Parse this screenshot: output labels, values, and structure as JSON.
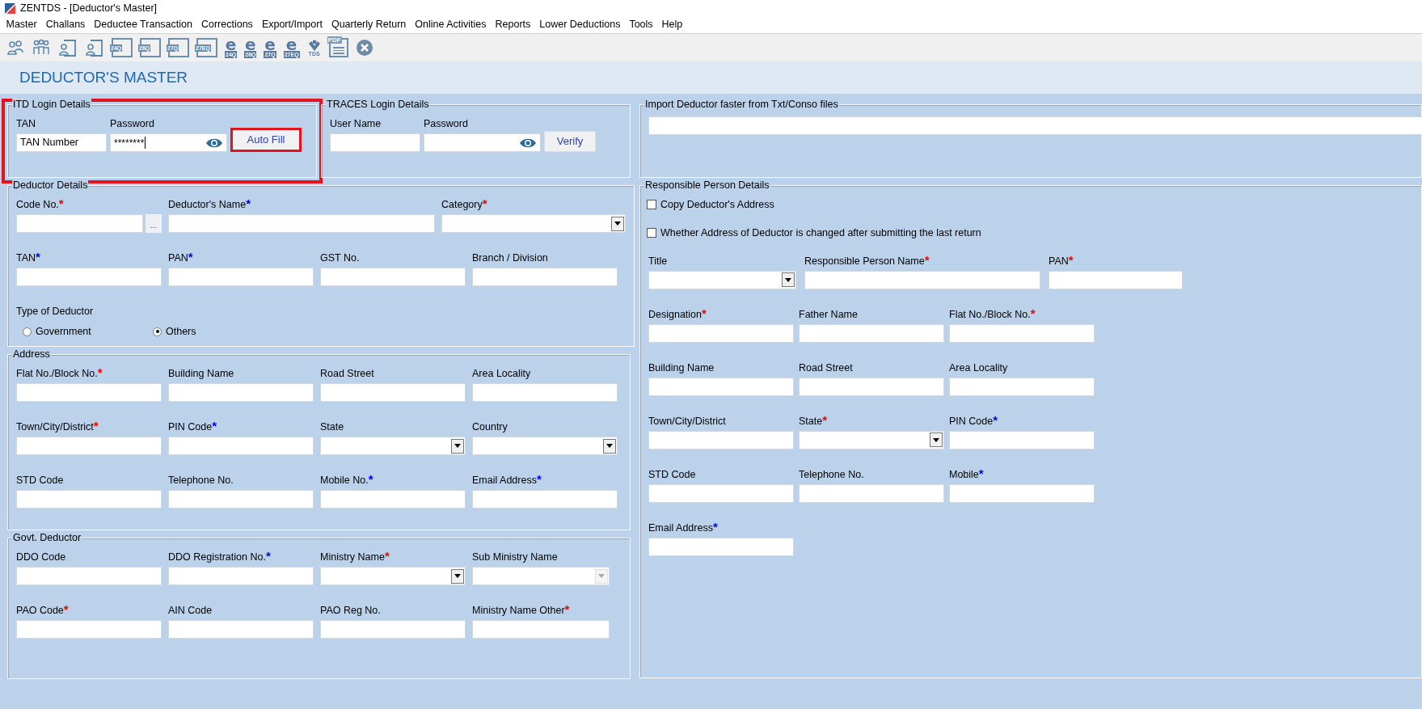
{
  "window": {
    "title": "ZENTDS - [Deductor's Master]"
  },
  "menu": [
    "Master",
    "Challans",
    "Deductee Transaction",
    "Corrections",
    "Export/Import",
    "Quarterly Return",
    "Online Activities",
    "Reports",
    "Lower Deductions",
    "Tools",
    "Help"
  ],
  "toolbar": [
    {
      "kind": "person-pair"
    },
    {
      "kind": "group"
    },
    {
      "kind": "person-form"
    },
    {
      "kind": "person-form"
    },
    {
      "kind": "form",
      "label": "24Q"
    },
    {
      "kind": "form",
      "label": "26Q"
    },
    {
      "kind": "form",
      "label": "27Q"
    },
    {
      "kind": "form",
      "label": "27EQ"
    },
    {
      "kind": "e-form",
      "glyph": "e",
      "label": "24Q"
    },
    {
      "kind": "e-form",
      "glyph": "e",
      "label": "26Q"
    },
    {
      "kind": "e-form",
      "glyph": "e",
      "label": "27Q"
    },
    {
      "kind": "e-form",
      "glyph": "e",
      "label": "27EQ"
    },
    {
      "kind": "tds",
      "label": "TDS"
    },
    {
      "kind": "pdf",
      "label": "PDF"
    },
    {
      "kind": "close"
    }
  ],
  "page_title": "DEDUCTOR'S MASTER",
  "left_top": [
    {
      "title": "ITD Login Details",
      "highlighted": true,
      "rows": [
        {
          "kind": "fields",
          "fields": [
            {
              "kind": "text",
              "label": "TAN",
              "value": "TAN Number"
            },
            {
              "kind": "password",
              "label": "Password",
              "value": "********"
            },
            {
              "kind": "button",
              "label": "Auto Fill",
              "highlighted": true
            }
          ]
        }
      ]
    },
    {
      "title": "TRACES Login Details",
      "highlighted": false,
      "rows": [
        {
          "kind": "fields",
          "fields": [
            {
              "kind": "text",
              "label": "User Name"
            },
            {
              "kind": "password",
              "label": "Password"
            },
            {
              "kind": "button",
              "label": "Verify",
              "highlighted": false
            }
          ]
        }
      ]
    }
  ],
  "left": [
    {
      "title": "Deductor Details",
      "highlighted": false,
      "rows": [
        {
          "kind": "fields",
          "fields": [
            {
              "kind": "code",
              "label": "Code No.",
              "required": "*",
              "color": "#ff0000",
              "button": "..."
            },
            {
              "kind": "text",
              "label": "Deductor's Name",
              "required": "*",
              "color": "#0000ff"
            },
            {
              "kind": "combo",
              "label": "Category",
              "required": "*",
              "color": "#ff0000"
            }
          ]
        },
        {
          "kind": "fields",
          "fields": [
            {
              "kind": "text",
              "label": "TAN",
              "required": "*",
              "color": "#0000ff"
            },
            {
              "kind": "text",
              "label": "PAN",
              "required": "*",
              "color": "#0000ff"
            },
            {
              "kind": "text",
              "label": "GST No."
            },
            {
              "kind": "text",
              "label": "Branch / Division"
            }
          ]
        },
        {
          "kind": "radios",
          "label": "Type of Deductor",
          "options": [
            {
              "label": "Government",
              "selected": false
            },
            {
              "label": "Others",
              "selected": true
            }
          ]
        }
      ]
    },
    {
      "title": "Address",
      "highlighted": false,
      "rows": [
        {
          "kind": "fields",
          "fields": [
            {
              "kind": "text",
              "label": "Flat No./Block No.",
              "required": "*",
              "color": "#ff0000"
            },
            {
              "kind": "text",
              "label": "Building Name"
            },
            {
              "kind": "text",
              "label": "Road Street"
            },
            {
              "kind": "text",
              "label": "Area Locality"
            }
          ]
        },
        {
          "kind": "fields",
          "fields": [
            {
              "kind": "text",
              "label": "Town/City/District",
              "required": "*",
              "color": "#ff0000"
            },
            {
              "kind": "text",
              "label": "PIN Code",
              "required": "*",
              "color": "#0000ff"
            },
            {
              "kind": "combo",
              "label": "State"
            },
            {
              "kind": "combo",
              "label": "Country"
            }
          ]
        },
        {
          "kind": "fields",
          "fields": [
            {
              "kind": "text",
              "label": "STD Code"
            },
            {
              "kind": "text",
              "label": "Telephone No."
            },
            {
              "kind": "text",
              "label": "Mobile No.",
              "required": "*",
              "color": "#0000ff"
            },
            {
              "kind": "text",
              "label": "Email Address",
              "required": "*",
              "color": "#0000ff"
            }
          ]
        }
      ]
    },
    {
      "title": "Govt. Deductor",
      "highlighted": false,
      "rows": [
        {
          "kind": "fields",
          "fields": [
            {
              "kind": "text",
              "label": "DDO Code"
            },
            {
              "kind": "text",
              "label": "DDO Registration No.",
              "required": "*",
              "color": "#0000ff"
            },
            {
              "kind": "combo",
              "label": "Ministry Name",
              "required": "*",
              "color": "#ff0000"
            },
            {
              "kind": "combo",
              "label": "Sub Ministry Name",
              "disabled": true
            }
          ]
        },
        {
          "kind": "fields",
          "fields": [
            {
              "kind": "text",
              "label": "PAO Code",
              "required": "*",
              "color": "#ff0000"
            },
            {
              "kind": "text",
              "label": "AIN Code"
            },
            {
              "kind": "text",
              "label": "PAO Reg No."
            },
            {
              "kind": "text",
              "label": "Ministry Name Other",
              "required": "*",
              "color": "#ff0000"
            }
          ]
        }
      ]
    }
  ],
  "right": [
    {
      "title": "Import Deductor faster from Txt/Conso files",
      "highlighted": false,
      "rows": [
        {
          "kind": "fields",
          "fields": [
            {
              "kind": "text"
            }
          ]
        }
      ]
    },
    {
      "title": "Responsible Person Details",
      "highlighted": false,
      "rows": [
        {
          "kind": "checkbox",
          "label": "Copy Deductor's Address",
          "checked": false
        },
        {
          "kind": "checkbox",
          "label": "Whether Address of Deductor is changed after submitting the last return",
          "checked": false
        },
        {
          "kind": "fields",
          "fields": [
            {
              "kind": "combo",
              "label": "Title"
            },
            {
              "kind": "text",
              "label": "Responsible Person Name",
              "required": "*",
              "color": "#ff0000"
            },
            {
              "kind": "text",
              "label": "PAN",
              "required": "*",
              "color": "#ff0000"
            }
          ]
        },
        {
          "kind": "fields",
          "fields": [
            {
              "kind": "text",
              "label": "Designation",
              "required": "*",
              "color": "#ff0000"
            },
            {
              "kind": "text",
              "label": "Father Name"
            },
            {
              "kind": "text",
              "label": "Flat No./Block No.",
              "required": "*",
              "color": "#ff0000"
            }
          ]
        },
        {
          "kind": "fields",
          "fields": [
            {
              "kind": "text",
              "label": "Building Name"
            },
            {
              "kind": "text",
              "label": "Road Street"
            },
            {
              "kind": "text",
              "label": "Area Locality"
            }
          ]
        },
        {
          "kind": "fields",
          "fields": [
            {
              "kind": "text",
              "label": "Town/City/District"
            },
            {
              "kind": "combo",
              "label": "State",
              "required": "*",
              "color": "#ff0000"
            },
            {
              "kind": "text",
              "label": "PIN Code",
              "required": "*",
              "color": "#0000ff"
            }
          ]
        },
        {
          "kind": "fields",
          "fields": [
            {
              "kind": "text",
              "label": "STD Code"
            },
            {
              "kind": "text",
              "label": "Telephone No."
            },
            {
              "kind": "text",
              "label": "Mobile",
              "required": "*",
              "color": "#0000ff"
            }
          ]
        },
        {
          "kind": "fields",
          "fields": [
            {
              "kind": "text",
              "label": "Email Address",
              "required": "*",
              "color": "#0000ff"
            }
          ]
        }
      ]
    }
  ]
}
